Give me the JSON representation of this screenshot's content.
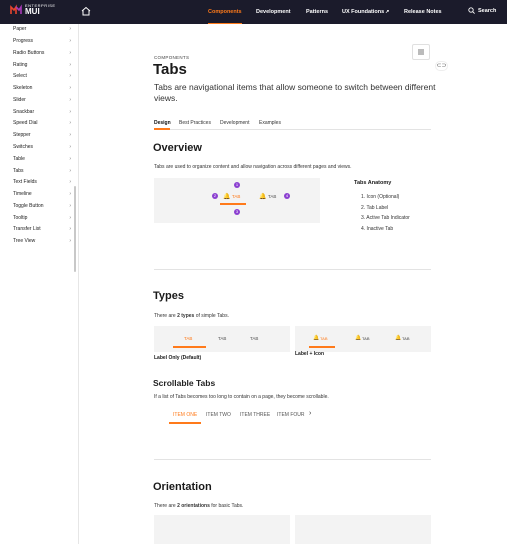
{
  "header": {
    "logo_small": "ENTERPRISE",
    "logo_big": "MUI",
    "nav": [
      "Components",
      "Development",
      "Patterns",
      "UX Foundations",
      "Release Notes"
    ],
    "search": "Search"
  },
  "sidebar": {
    "items": [
      "Paper",
      "Progress",
      "Radio Buttons",
      "Rating",
      "Select",
      "Skeleton",
      "Slider",
      "Snackbar",
      "Speed Dial",
      "Stepper",
      "Switches",
      "Table",
      "Tabs",
      "Text Fields",
      "Timeline",
      "Toggle Button",
      "Tooltip",
      "Transfer List",
      "Tree View"
    ]
  },
  "page": {
    "eyebrow": "COMPONENTS",
    "title": "Tabs",
    "subtitle_line1": "Tabs are navigational items that allow someone to switch between different",
    "subtitle_line2": "views.",
    "tabs": [
      "Design",
      "Best Practices",
      "Development",
      "Examples"
    ]
  },
  "overview": {
    "heading": "Overview",
    "body": "Tabs are used to organize content and allow navigation across different pages and views.",
    "demo_active": "TAB",
    "demo_inactive": "TAB",
    "anatomy_title": "Tabs Anatomy",
    "anatomy": [
      "1. Icon (Optional)",
      "2. Tab Label",
      "3. Active Tab Indicator",
      "4. Inactive Tab"
    ],
    "markers": [
      "1",
      "2",
      "3",
      "4"
    ]
  },
  "types": {
    "heading": "Types",
    "body_pre": "There are ",
    "body_bold": "2 types",
    "body_post": " of simple Tabs.",
    "label_only_tabs": [
      "TAB",
      "TAB",
      "TAB"
    ],
    "icon_tabs": [
      "TAB",
      "TAB",
      "TAB"
    ],
    "label_only_caption": "Label Only (Default)",
    "label_icon_caption": "Label + Icon"
  },
  "scrollable": {
    "heading": "Scrollable Tabs",
    "body": "If a list of Tabs becomes too long to contain on a page, they become scrollable.",
    "items": [
      "ITEM ONE",
      "ITEM TWO",
      "ITEM THREE",
      "ITEM FOUR"
    ]
  },
  "orientation": {
    "heading": "Orientation",
    "body_pre": "There are ",
    "body_bold": "2 orientations",
    "body_post": " for basic Tabs."
  },
  "colors": {
    "accent": "#ff7a1a",
    "header": "#1b1b2b",
    "marker": "#8b3fd0"
  }
}
